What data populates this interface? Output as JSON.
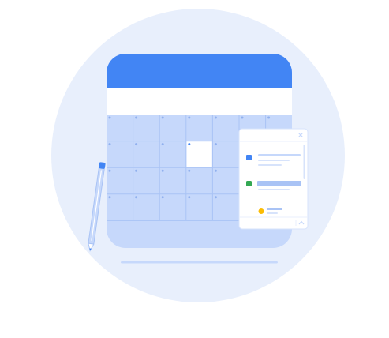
{
  "illustration": {
    "subject": "calendar-with-event-panel",
    "colors": {
      "background_circle": "#e8effc",
      "calendar_body": "#c6d8fb",
      "calendar_header": "#4285f4",
      "calendar_band": "#ffffff",
      "grid_lines": "#a9c3f5",
      "grid_dot": "#90b0ee",
      "selected_cell": "#ffffff",
      "selected_dot": "#4285f4",
      "panel": "#ffffff",
      "panel_line": "#d7e3fb",
      "event_blue": "#4285f4",
      "event_green": "#34a853",
      "event_yellow": "#fbbc04",
      "pencil": "#c6d8fb",
      "pencil_cap": "#4285f4",
      "base_line": "#c6d8fb"
    },
    "icons": [
      "close-icon",
      "chevron-up-icon",
      "pencil-icon"
    ],
    "grid": {
      "rows": 4,
      "cols": 7,
      "selected_row": 1,
      "selected_col": 3
    }
  }
}
